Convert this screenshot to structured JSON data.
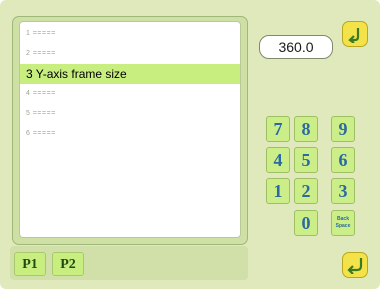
{
  "list": {
    "items": [
      {
        "label": "1 ====="
      },
      {
        "label": "2 ====="
      },
      {
        "label": "3 Y-axis frame size"
      },
      {
        "label": "4 ====="
      },
      {
        "label": "5 ====="
      },
      {
        "label": "6 ====="
      }
    ],
    "selected_index": 2
  },
  "value": {
    "display": "360.0"
  },
  "keypad": {
    "keys": [
      "7",
      "8",
      "9",
      "4",
      "5",
      "6",
      "1",
      "2",
      "3",
      "0"
    ],
    "back_space_label": "Back Space"
  },
  "pages": {
    "tabs": [
      "P1",
      "P2"
    ]
  },
  "icons": {
    "top_right": "undo-arrow-icon",
    "bottom_right": "enter-arrow-icon"
  },
  "colors": {
    "background": "#dfe9bc",
    "selected_row": "#c8ee7f",
    "key_fill": "#ccee88",
    "key_text": "#2b6aa0",
    "icon_button": "#f4e24a"
  }
}
